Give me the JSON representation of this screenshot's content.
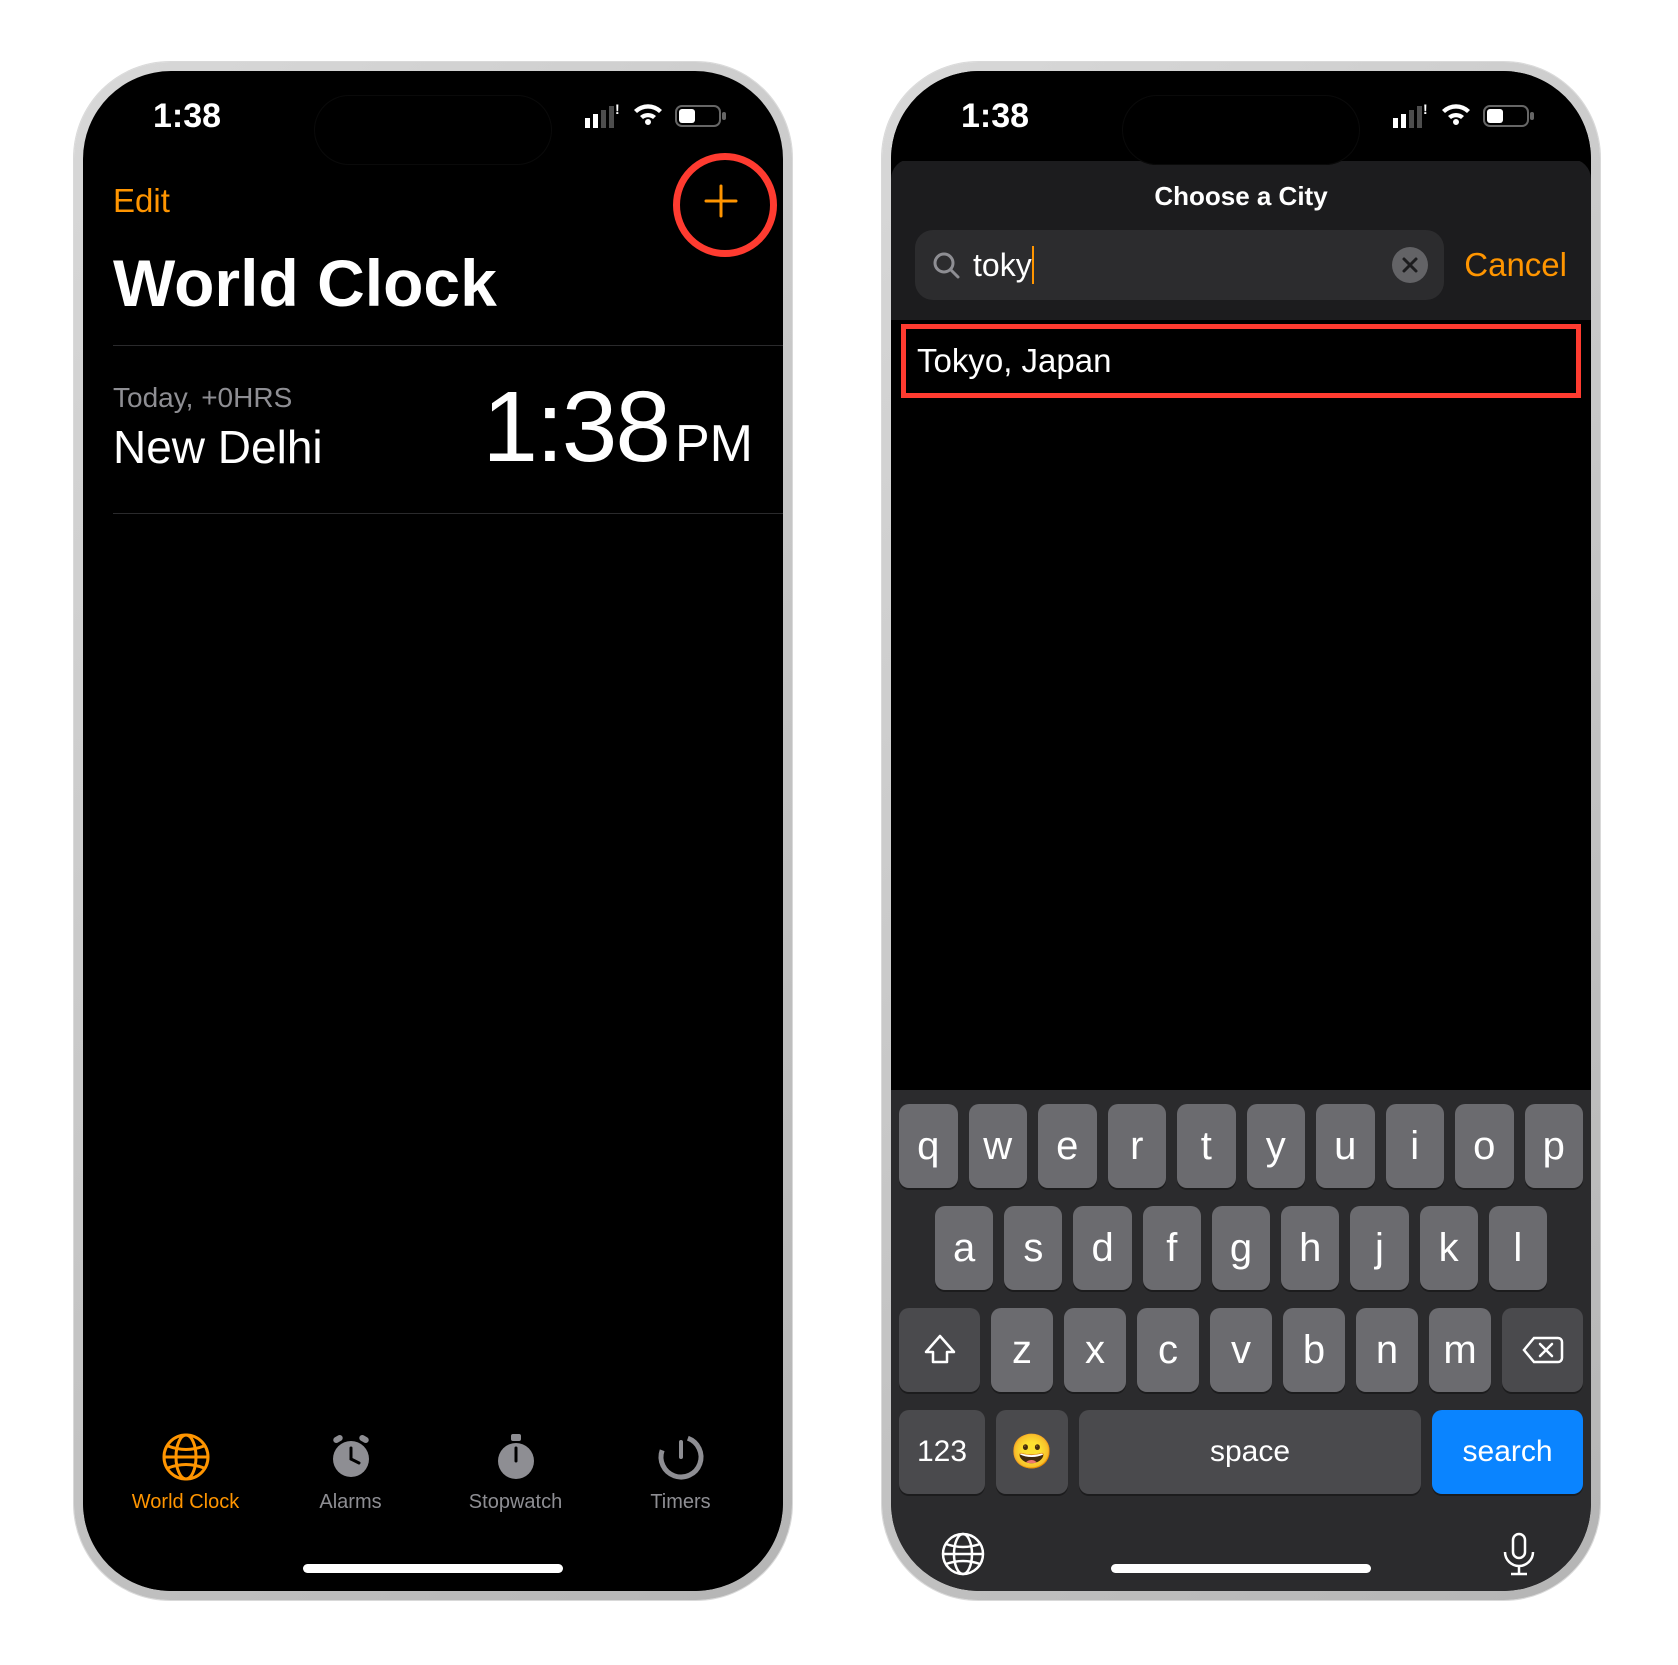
{
  "statusbar": {
    "time": "1:38"
  },
  "left": {
    "edit_label": "Edit",
    "title": "World Clock",
    "clocks": [
      {
        "offset": "Today, +0HRS",
        "city": "New Delhi",
        "time": "1:38",
        "ampm": "PM"
      }
    ],
    "tabs": [
      {
        "label": "World Clock",
        "active": true
      },
      {
        "label": "Alarms",
        "active": false
      },
      {
        "label": "Stopwatch",
        "active": false
      },
      {
        "label": "Timers",
        "active": false
      }
    ]
  },
  "right": {
    "sheet_title": "Choose a City",
    "search_value": "toky",
    "cancel_label": "Cancel",
    "results": [
      "Tokyo, Japan"
    ],
    "keyboard": {
      "row1": [
        "q",
        "w",
        "e",
        "r",
        "t",
        "y",
        "u",
        "i",
        "o",
        "p"
      ],
      "row2": [
        "a",
        "s",
        "d",
        "f",
        "g",
        "h",
        "j",
        "k",
        "l"
      ],
      "row3": [
        "z",
        "x",
        "c",
        "v",
        "b",
        "n",
        "m"
      ],
      "n123": "123",
      "space": "space",
      "search": "search"
    }
  }
}
